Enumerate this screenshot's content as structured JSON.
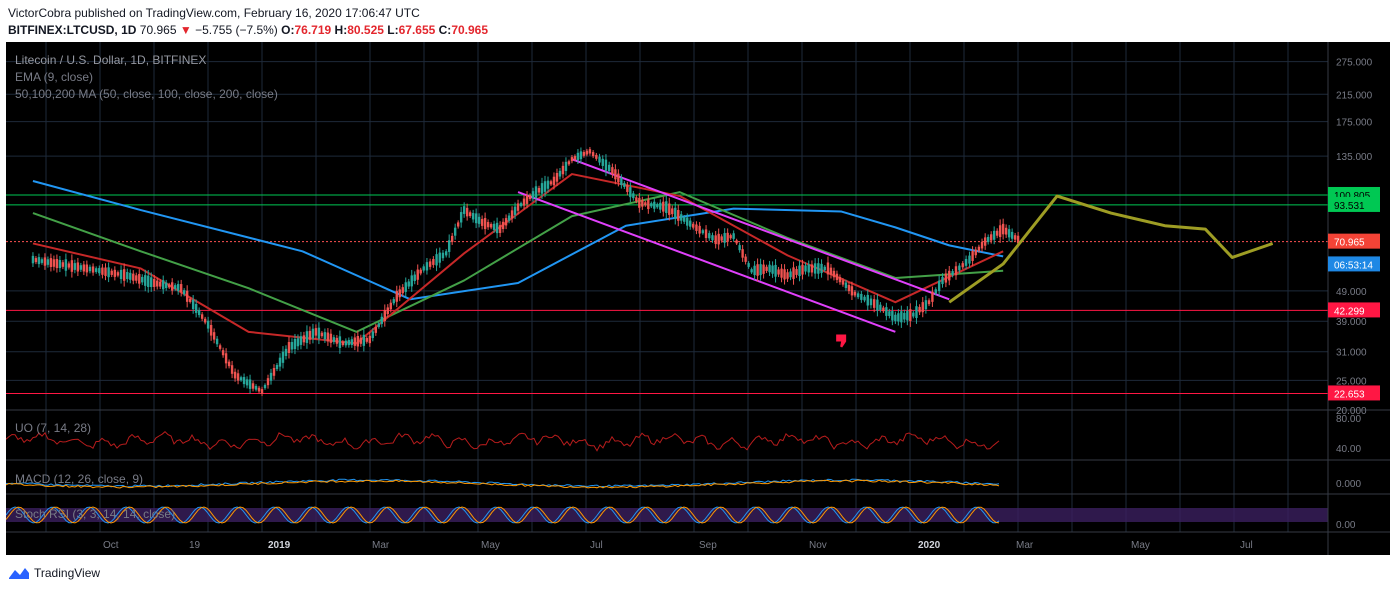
{
  "header": {
    "line1": "VictorCobra published on TradingView.com, February 16, 2020 17:06:47 UTC",
    "symbol": "BITFINEX:LTCUSD, 1D",
    "last": "70.965",
    "change": "−5.755 (−7.5%)",
    "o_label": "O:",
    "o_val": "76.719",
    "h_label": "H:",
    "h_val": "80.525",
    "l_label": "L:",
    "l_val": "67.655",
    "c_label": "C:",
    "c_val": "70.965"
  },
  "legend": {
    "title": "Litecoin / U.S. Dollar, 1D, BITFINEX",
    "ema": "EMA (9, close)",
    "ma": "50,100,200 MA (50, close, 100, close, 200, close)",
    "uo": "UO (7, 14, 28)",
    "macd": "MACD (12, 26, close, 9)",
    "stoch": "Stoch RSI (3, 3, 14, 14, close)"
  },
  "footer": {
    "brand": "TradingView"
  },
  "chart_data": {
    "type": "line",
    "symbol": "LTC/USD",
    "x_labels": [
      "Oct",
      "19",
      "2019",
      "Mar",
      "May",
      "Jul",
      "Sep",
      "Nov",
      "2020",
      "Mar",
      "May",
      "Jul"
    ],
    "price_axis": {
      "scale": "log",
      "ticks": [
        275,
        215,
        175,
        135,
        49,
        39,
        31,
        25,
        20
      ],
      "tick_labels": [
        "275.000",
        "215.000",
        "175.000",
        "135.000",
        "49.000",
        "39.000",
        "31.000",
        "25.000",
        "20.000"
      ],
      "range": [
        20,
        300
      ]
    },
    "levels": [
      {
        "value": 100.805,
        "label": "100.805",
        "color": "#00c853",
        "kind": "line"
      },
      {
        "value": 93.531,
        "label": "93.531",
        "color": "#00c853",
        "kind": "line"
      },
      {
        "value": 70.965,
        "label": "70.965",
        "color": "#ff5252",
        "kind": "dotted"
      },
      {
        "value": 42.299,
        "label": "42.299",
        "color": "#ff1744",
        "kind": "line"
      },
      {
        "value": 22.653,
        "label": "22.653",
        "color": "#ff1744",
        "kind": "line"
      }
    ],
    "countdown": {
      "value": 63.5,
      "label": "06:53:14",
      "color": "#1e88e5"
    },
    "close_path": [
      [
        "Aug 2018",
        62
      ],
      [
        "Sep 2018",
        58
      ],
      [
        "Oct 2018",
        55
      ],
      [
        "Oct 2018",
        52
      ],
      [
        "Nov 2018",
        50
      ],
      [
        "Nov 2018",
        38
      ],
      [
        "Dec 2018",
        26
      ],
      [
        "Dec 2018",
        23
      ],
      [
        "Jan 2019",
        32
      ],
      [
        "Jan 2019",
        36
      ],
      [
        "Feb 2019",
        33
      ],
      [
        "Feb 2019",
        34
      ],
      [
        "Mar 2019",
        47
      ],
      [
        "Mar 2019",
        58
      ],
      [
        "Apr 2019",
        65
      ],
      [
        "Apr 2019",
        90
      ],
      [
        "Apr 2019",
        82
      ],
      [
        "May 2019",
        78
      ],
      [
        "May 2019",
        92
      ],
      [
        "May 2019",
        103
      ],
      [
        "Jun 2019",
        112
      ],
      [
        "Jun 2019",
        132
      ],
      [
        "Jun 2019",
        140
      ],
      [
        "Jul 2019",
        121
      ],
      [
        "Jul 2019",
        95
      ],
      [
        "Aug 2019",
        92
      ],
      [
        "Aug 2019",
        80
      ],
      [
        "Sep 2019",
        72
      ],
      [
        "Sep 2019",
        74
      ],
      [
        "Sep 2019",
        57
      ],
      [
        "Oct 2019",
        58
      ],
      [
        "Oct 2019",
        55
      ],
      [
        "Oct 2019",
        58
      ],
      [
        "Nov 2019",
        58
      ],
      [
        "Nov 2019",
        48
      ],
      [
        "Dec 2019",
        44
      ],
      [
        "Dec 2019",
        40
      ],
      [
        "Dec 2019",
        41
      ],
      [
        "Jan 2020",
        45
      ],
      [
        "Jan 2020",
        53
      ],
      [
        "Jan 2020",
        57
      ],
      [
        "Jan 2020",
        62
      ],
      [
        "Feb 2020",
        71
      ],
      [
        "Feb 2020",
        78
      ],
      [
        "Feb 2020",
        70.965
      ]
    ],
    "ma200": [
      [
        "Aug 2018",
        112
      ],
      [
        "Oct 2018",
        90
      ],
      [
        "Jan 2019",
        66
      ],
      [
        "Mar 2019",
        46
      ],
      [
        "May 2019",
        52
      ],
      [
        "Jul 2019",
        80
      ],
      [
        "Sep 2019",
        91
      ],
      [
        "Nov 2019",
        89
      ],
      [
        "Dec 2019",
        79
      ],
      [
        "Jan 2020",
        69
      ],
      [
        "Feb 2020",
        63.5
      ]
    ],
    "ma100": [
      [
        "Aug 2018",
        88
      ],
      [
        "Oct 2018",
        66
      ],
      [
        "Dec 2018",
        50
      ],
      [
        "Feb 2019",
        36
      ],
      [
        "Apr 2019",
        53
      ],
      [
        "Jun 2019",
        86
      ],
      [
        "Aug 2019",
        103
      ],
      [
        "Oct 2019",
        73
      ],
      [
        "Dec 2019",
        54
      ],
      [
        "Feb 2020",
        57
      ]
    ],
    "ma50": [
      [
        "Aug 2018",
        70
      ],
      [
        "Oct 2018",
        58
      ],
      [
        "Dec 2018",
        36
      ],
      [
        "Feb 2019",
        33
      ],
      [
        "Apr 2019",
        65
      ],
      [
        "Jun 2019",
        118
      ],
      [
        "Aug 2019",
        100
      ],
      [
        "Oct 2019",
        64
      ],
      [
        "Dec 2019",
        45
      ],
      [
        "Feb 2020",
        66
      ]
    ],
    "projection": [
      [
        "Jan 2020",
        45
      ],
      [
        "Feb 2020",
        60
      ],
      [
        "Mar 2020",
        100
      ],
      [
        "Apr 2020",
        88
      ],
      [
        "May 2020",
        80
      ],
      [
        "Jun 2020",
        78
      ],
      [
        "Jun 2020",
        63
      ],
      [
        "Jul 2020",
        70
      ]
    ],
    "channel": {
      "upper": [
        [
          "Jun 2019",
          132
        ],
        [
          "Jan 2020",
          46
        ]
      ],
      "lower": [
        [
          "May 2019",
          103
        ],
        [
          "Dec 2019",
          36
        ]
      ],
      "color": "#e040fb"
    },
    "marker": {
      "date": "Nov 2019",
      "value": 34,
      "name": "thumbs-down-icon",
      "color": "#ff1744"
    },
    "indicators": {
      "uo": {
        "ticks": [
          "80.00",
          "40.00"
        ],
        "range": [
          30,
          90
        ]
      },
      "macd": {
        "ticks": [
          "0.000"
        ]
      },
      "stoch": {
        "ticks": [
          "0.00"
        ],
        "band": [
          20,
          80
        ]
      }
    }
  }
}
